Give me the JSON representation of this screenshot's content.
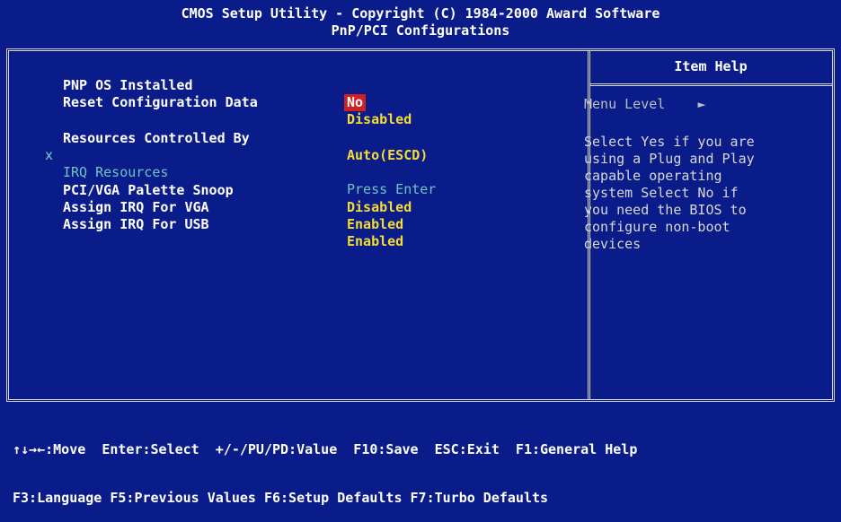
{
  "header": {
    "title": "CMOS Setup Utility - Copyright (C) 1984-2000 Award Software",
    "subtitle": "PnP/PCI Configurations"
  },
  "settings": [
    {
      "label": "PNP OS Installed",
      "value": "No",
      "selected": true,
      "disabled": false
    },
    {
      "label": "Reset Configuration Data",
      "value": "Disabled",
      "selected": false,
      "disabled": false
    },
    {
      "label": "Resources Controlled By",
      "value": "Auto(ESCD)",
      "selected": false,
      "disabled": false
    },
    {
      "label": "IRQ Resources",
      "value": "Press Enter",
      "marker": "x",
      "selected": false,
      "disabled": true
    },
    {
      "label": "PCI/VGA Palette Snoop",
      "value": "Disabled",
      "selected": false,
      "disabled": false
    },
    {
      "label": "Assign IRQ For VGA",
      "value": "Enabled",
      "selected": false,
      "disabled": false
    },
    {
      "label": "Assign IRQ For USB",
      "value": "Enabled",
      "selected": false,
      "disabled": false
    }
  ],
  "help": {
    "title": "Item Help",
    "menu_level_label": "Menu Level",
    "menu_level_arrow": "►",
    "text": "Select Yes if you are\nusing a Plug and Play\ncapable operating\nsystem Select No if\nyou need the BIOS to\nconfigure non-boot\ndevices"
  },
  "footer": {
    "line1": "↑↓→←:Move  Enter:Select  +/-/PU/PD:Value  F10:Save  ESC:Exit  F1:General Help",
    "line2": "F3:Language F5:Previous Values F6:Setup Defaults F7:Turbo Defaults"
  },
  "colors": {
    "background": "#0a1c8a",
    "value": "#f5dc32",
    "selected_bg": "#d02020",
    "disabled": "#6fc4c4"
  }
}
